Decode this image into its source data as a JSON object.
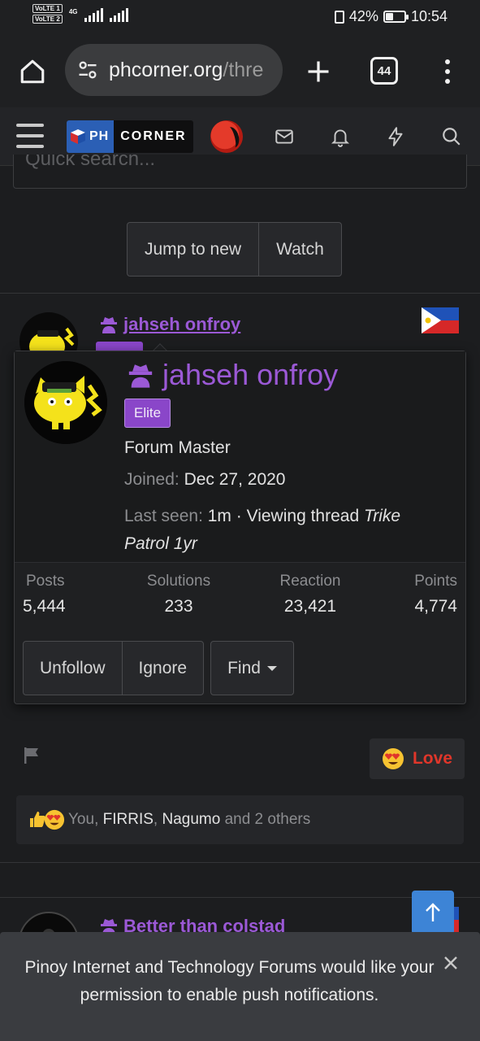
{
  "statusbar": {
    "volte1": "VoLTE 1",
    "volte2": "VoLTE 2",
    "network": "4G",
    "battery": "42%",
    "battery_level": 0.42,
    "time": "10:54"
  },
  "browser": {
    "url_domain": "phcorner.org",
    "url_path": "/thre",
    "tab_count": "44"
  },
  "site": {
    "logo_left": "PH",
    "logo_right": "CORNER"
  },
  "thread": {
    "quick_search_placeholder": "Quick search...",
    "jump_label": "Jump to new",
    "watch_label": "Watch"
  },
  "post": {
    "author": "jahseh onfroy"
  },
  "member_card": {
    "name": "jahseh onfroy",
    "badge": "Elite",
    "title": "Forum Master",
    "joined_label": "Joined:",
    "joined_value": "Dec 27, 2020",
    "last_seen_label": "Last seen:",
    "last_seen_value": "1m · Viewing thread",
    "last_seen_thread": "Trike Patrol 1yr",
    "stats": [
      {
        "label": "Posts",
        "value": "5,444"
      },
      {
        "label": "Solutions",
        "value": "233"
      },
      {
        "label": "Reaction",
        "value": "23,421"
      },
      {
        "label": "Points",
        "value": "4,774"
      }
    ],
    "unfollow_label": "Unfollow",
    "ignore_label": "Ignore",
    "find_label": "Find"
  },
  "post_footer": {
    "love_label": "Love",
    "reactions_you": "You",
    "reactions_sep1": ",",
    "reactions_name1": "FIRRIS",
    "reactions_sep2": ",",
    "reactions_name2": "Nagumo",
    "reactions_rest": "and 2 others"
  },
  "next_post": {
    "author": "Better than colstad"
  },
  "push": {
    "message": "Pinoy Internet and Technology Forums would like your permission to enable push notifications."
  },
  "colors": {
    "accent_purple": "#9b59d6",
    "badge_purple": "#8a46c9",
    "love_red": "#e0362a",
    "scroll_blue": "#3d84d6"
  }
}
